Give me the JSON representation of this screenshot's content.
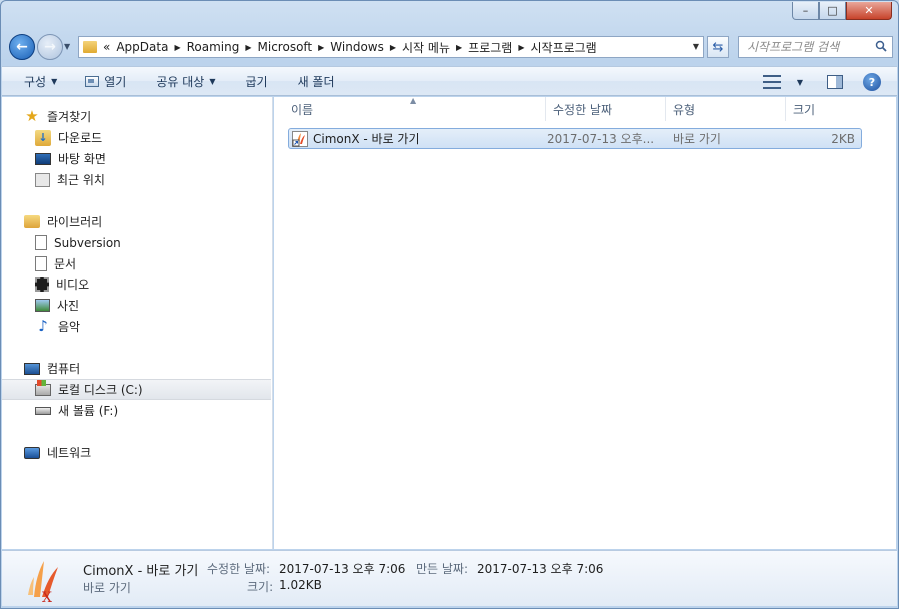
{
  "window": {
    "caption": {
      "minimize": "–",
      "maximize": "□",
      "close": "✕"
    }
  },
  "address": {
    "overflow_chevron": "«",
    "crumbs": [
      "AppData",
      "Roaming",
      "Microsoft",
      "Windows",
      "시작 메뉴",
      "프로그램",
      "시작프로그램"
    ]
  },
  "search": {
    "placeholder": "시작프로그램 검색"
  },
  "toolbar": {
    "organize": "구성",
    "open": "열기",
    "share": "공유 대상",
    "burn": "굽기",
    "new_folder": "새 폴더"
  },
  "nav": {
    "favorites": {
      "label": "즐겨찾기",
      "items": [
        "다운로드",
        "바탕 화면",
        "최근 위치"
      ]
    },
    "libraries": {
      "label": "라이브러리",
      "items": [
        "Subversion",
        "문서",
        "비디오",
        "사진",
        "음악"
      ]
    },
    "computer": {
      "label": "컴퓨터",
      "items": [
        "로컬 디스크 (C:)",
        "새 볼륨 (F:)"
      ]
    },
    "network": {
      "label": "네트워크"
    }
  },
  "columns": {
    "name": "이름",
    "date": "수정한 날짜",
    "type": "유형",
    "size": "크기"
  },
  "files": [
    {
      "name": "CimonX - 바로 가기",
      "date": "2017-07-13 오후...",
      "type": "바로 가기",
      "size": "2KB"
    }
  ],
  "details": {
    "name": "CimonX - 바로 가기",
    "type": "바로 가기",
    "modified_label": "수정한 날짜:",
    "modified": "2017-07-13 오후 7:06",
    "created_label": "만든 날짜:",
    "created": "2017-07-13 오후 7:06",
    "size_label": "크기:",
    "size": "1.02KB"
  },
  "colors": {
    "accent": "#1a5fb5",
    "selection": "#cfe1f5",
    "selection_border": "#84acdd"
  }
}
